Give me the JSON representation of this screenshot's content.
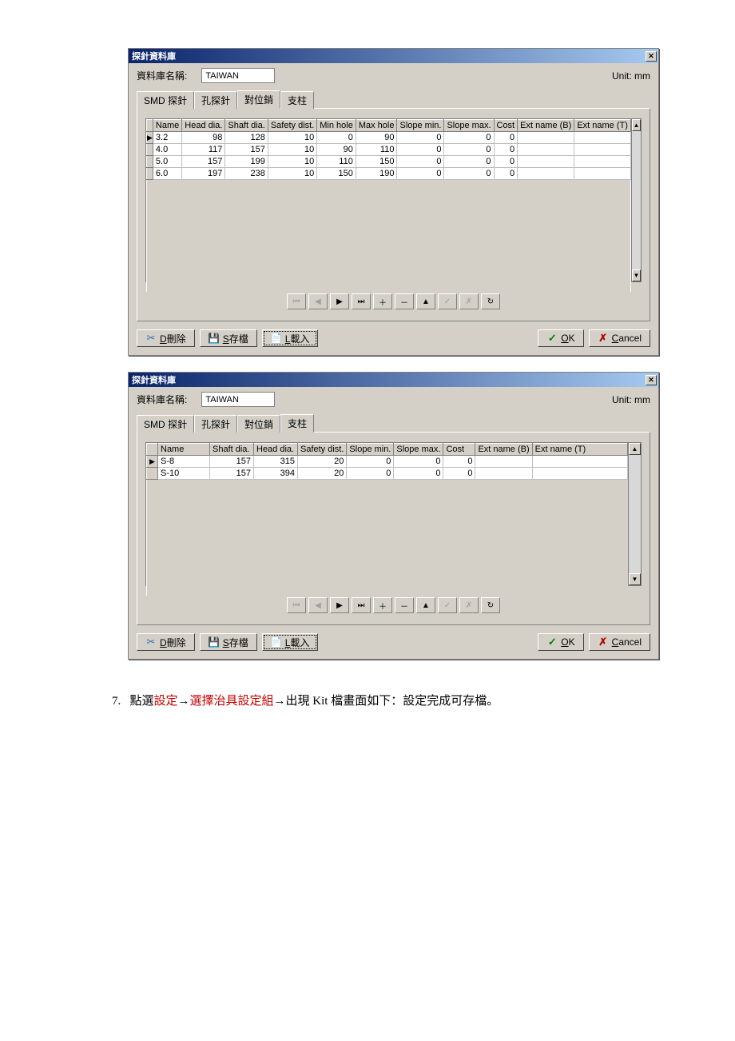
{
  "dialog1": {
    "title": "探針資料庫",
    "db_label": "資料庫名稱:",
    "db_value": "TAIWAN",
    "unit": "Unit: mm",
    "tabs": [
      "SMD 探針",
      "孔探針",
      "對位銷",
      "支柱"
    ],
    "active_tab": "對位銷",
    "headers": [
      "Name",
      "Head dia.",
      "Shaft dia.",
      "Safety dist.",
      "Min hole",
      "Max hole",
      "Slope min.",
      "Slope max.",
      "Cost",
      "Ext name (B)",
      "Ext name (T)"
    ],
    "rows": [
      {
        "sel": "▶",
        "c": [
          "3.2",
          "98",
          "128",
          "10",
          "0",
          "90",
          "0",
          "0",
          "0",
          "",
          ""
        ]
      },
      {
        "sel": "",
        "c": [
          "4.0",
          "117",
          "157",
          "10",
          "90",
          "110",
          "0",
          "0",
          "0",
          "",
          ""
        ]
      },
      {
        "sel": "",
        "c": [
          "5.0",
          "157",
          "199",
          "10",
          "110",
          "150",
          "0",
          "0",
          "0",
          "",
          ""
        ]
      },
      {
        "sel": "",
        "c": [
          "6.0",
          "197",
          "238",
          "10",
          "150",
          "190",
          "0",
          "0",
          "0",
          "",
          ""
        ]
      }
    ],
    "btn_delete": "D刪除",
    "btn_save": "S存檔",
    "btn_load": "L載入",
    "btn_ok": "OK",
    "btn_cancel": "Cancel"
  },
  "dialog2": {
    "title": "探針資料庫",
    "db_label": "資料庫名稱:",
    "db_value": "TAIWAN",
    "unit": "Unit: mm",
    "tabs": [
      "SMD 探針",
      "孔探針",
      "對位銷",
      "支柱"
    ],
    "active_tab": "支柱",
    "headers": [
      "Name",
      "Shaft dia.",
      "Head dia.",
      "Safety dist.",
      "Slope min.",
      "Slope max.",
      "Cost",
      "Ext name (B)",
      "Ext name (T)"
    ],
    "rows": [
      {
        "sel": "▶",
        "c": [
          "S-8",
          "157",
          "315",
          "20",
          "0",
          "0",
          "0",
          "",
          ""
        ]
      },
      {
        "sel": "",
        "c": [
          "S-10",
          "157",
          "394",
          "20",
          "0",
          "0",
          "0",
          "",
          ""
        ]
      }
    ],
    "btn_delete": "D刪除",
    "btn_save": "S存檔",
    "btn_load": "L載入",
    "btn_ok": "OK",
    "btn_cancel": "Cancel"
  },
  "doc": {
    "num": "7.",
    "pre": "點選",
    "r1": "設定",
    "arrow": "→",
    "r2": "選擇治具設定組",
    "post": "出現 Kit 檔畫面如下：設定完成可存檔。"
  }
}
